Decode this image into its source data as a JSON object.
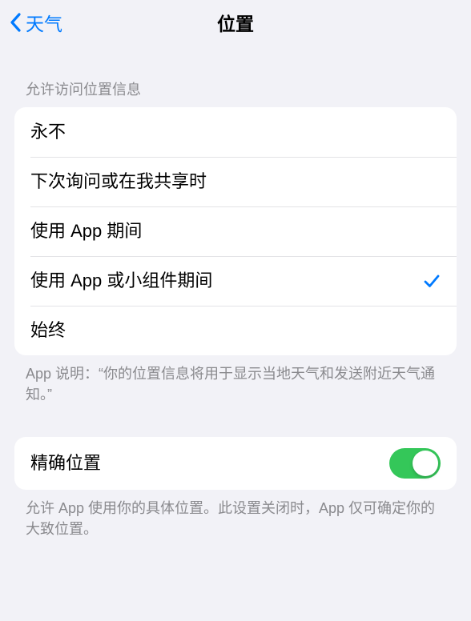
{
  "nav": {
    "back_label": "天气",
    "title": "位置"
  },
  "section1": {
    "header": "允许访问位置信息",
    "options": [
      {
        "label": "永不",
        "selected": false
      },
      {
        "label": "下次询问或在我共享时",
        "selected": false
      },
      {
        "label": "使用 App 期间",
        "selected": false
      },
      {
        "label": "使用 App 或小组件期间",
        "selected": true
      },
      {
        "label": "始终",
        "selected": false
      }
    ],
    "footer": "App 说明：“你的位置信息将用于显示当地天气和发送附近天气通知。”"
  },
  "section2": {
    "precise": {
      "label": "精确位置",
      "on": true
    },
    "footer": "允许 App 使用你的具体位置。此设置关闭时，App 仅可确定你的大致位置。"
  },
  "colors": {
    "accent": "#007aff",
    "toggle_on": "#34c759"
  }
}
